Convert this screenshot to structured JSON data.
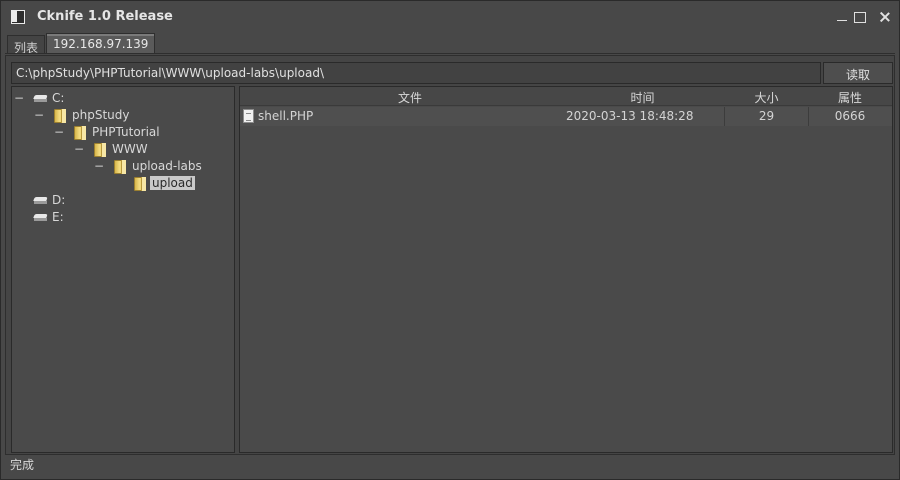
{
  "window": {
    "title": "Cknife 1.0 Release"
  },
  "tabs": [
    {
      "label": "列表"
    },
    {
      "label": "192.168.97.139"
    }
  ],
  "path_bar": {
    "value": "C:\\phpStudy\\PHPTutorial\\WWW\\upload-labs\\upload\\",
    "read_button": "读取"
  },
  "tree": [
    {
      "label": "C:",
      "toggle": "−",
      "type": "drive"
    },
    {
      "label": "phpStudy",
      "toggle": "−",
      "type": "folder"
    },
    {
      "label": "PHPTutorial",
      "toggle": "−",
      "type": "folder"
    },
    {
      "label": "WWW",
      "toggle": "−",
      "type": "folder"
    },
    {
      "label": "upload-labs",
      "toggle": "−",
      "type": "folder"
    },
    {
      "label": "upload",
      "toggle": "",
      "type": "folder",
      "selected": true
    },
    {
      "label": "D:",
      "toggle": "",
      "type": "drive"
    },
    {
      "label": "E:",
      "toggle": "",
      "type": "drive"
    }
  ],
  "files": {
    "columns": [
      "文件",
      "时间",
      "大小",
      "属性"
    ],
    "rows": [
      {
        "name": "shell.PHP",
        "time": "2020-03-13 18:48:28",
        "size": "29",
        "attr": "0666",
        "icon": "file-icon"
      }
    ]
  },
  "status": {
    "text": "完成"
  }
}
